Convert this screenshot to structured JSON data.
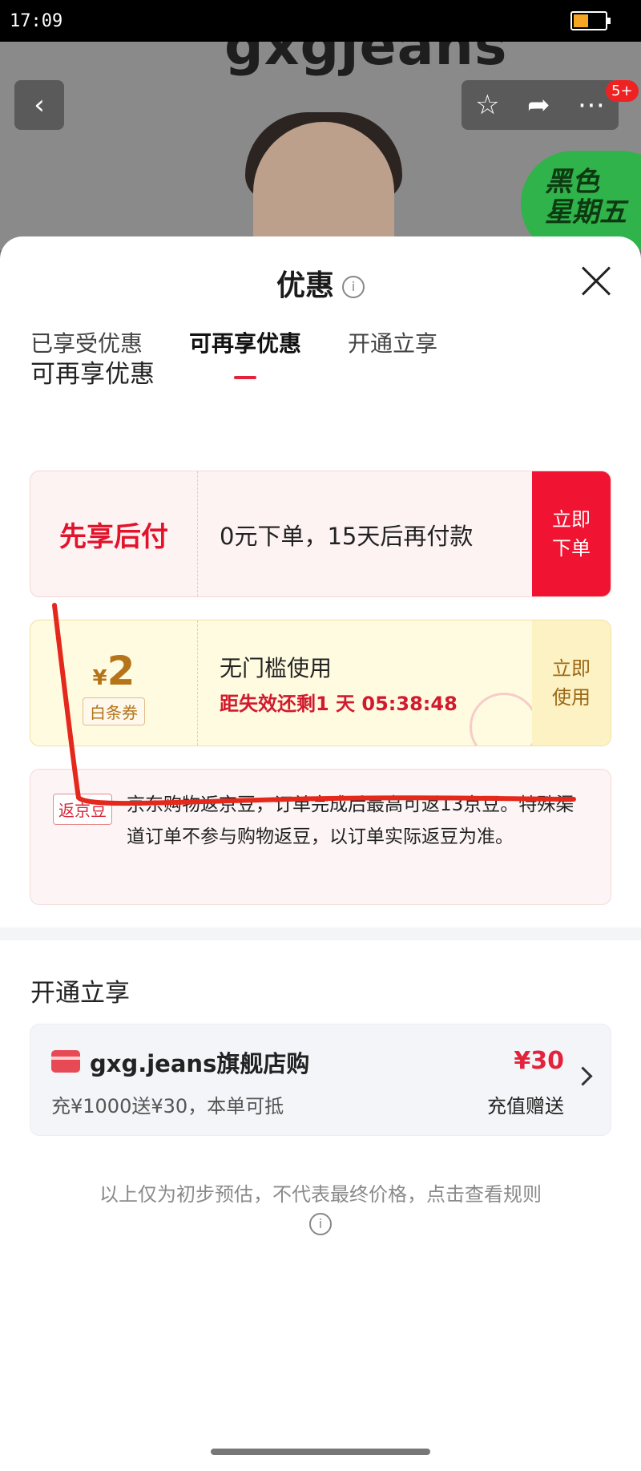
{
  "status_bar": {
    "time": "17:09"
  },
  "background_page": {
    "brand": "gxgjeans",
    "promo_text": "黑色\n星期五",
    "badge": "5+"
  },
  "sheet": {
    "title": "优惠",
    "tabs": [
      {
        "label": "已享受优惠"
      },
      {
        "label": "可再享优惠"
      },
      {
        "label": "开通立享"
      }
    ],
    "section_available": "可再享优惠",
    "bnpl": {
      "tag": "先享后付",
      "text": "0元下单，15天后再付款",
      "action": "立即\n下单"
    },
    "coupon": {
      "currency": "¥",
      "amount": "2",
      "tag": "白条券",
      "title": "无门槛使用",
      "expiry": "距失效还剩1 天 05:38:48",
      "action": "立即\n使用"
    },
    "beans": {
      "tag": "返京豆",
      "text": "京东购物返京豆，订单完成后最高可返13京豆。特殊渠道订单不参与购物返豆，以订单实际返豆为准。"
    },
    "section_open": "开通立享",
    "member": {
      "name": "gxg.jeans旗舰店购",
      "desc": "充¥1000送¥30，本单可抵",
      "price": "¥30",
      "price_label": "充值赠送"
    },
    "footnote": "以上仅为初步预估，不代表最终价格，点击查看规则"
  },
  "colors": {
    "accent": "#e2233b",
    "coupon_gold": "#b5731a",
    "annotation_red": "#e5281c"
  }
}
